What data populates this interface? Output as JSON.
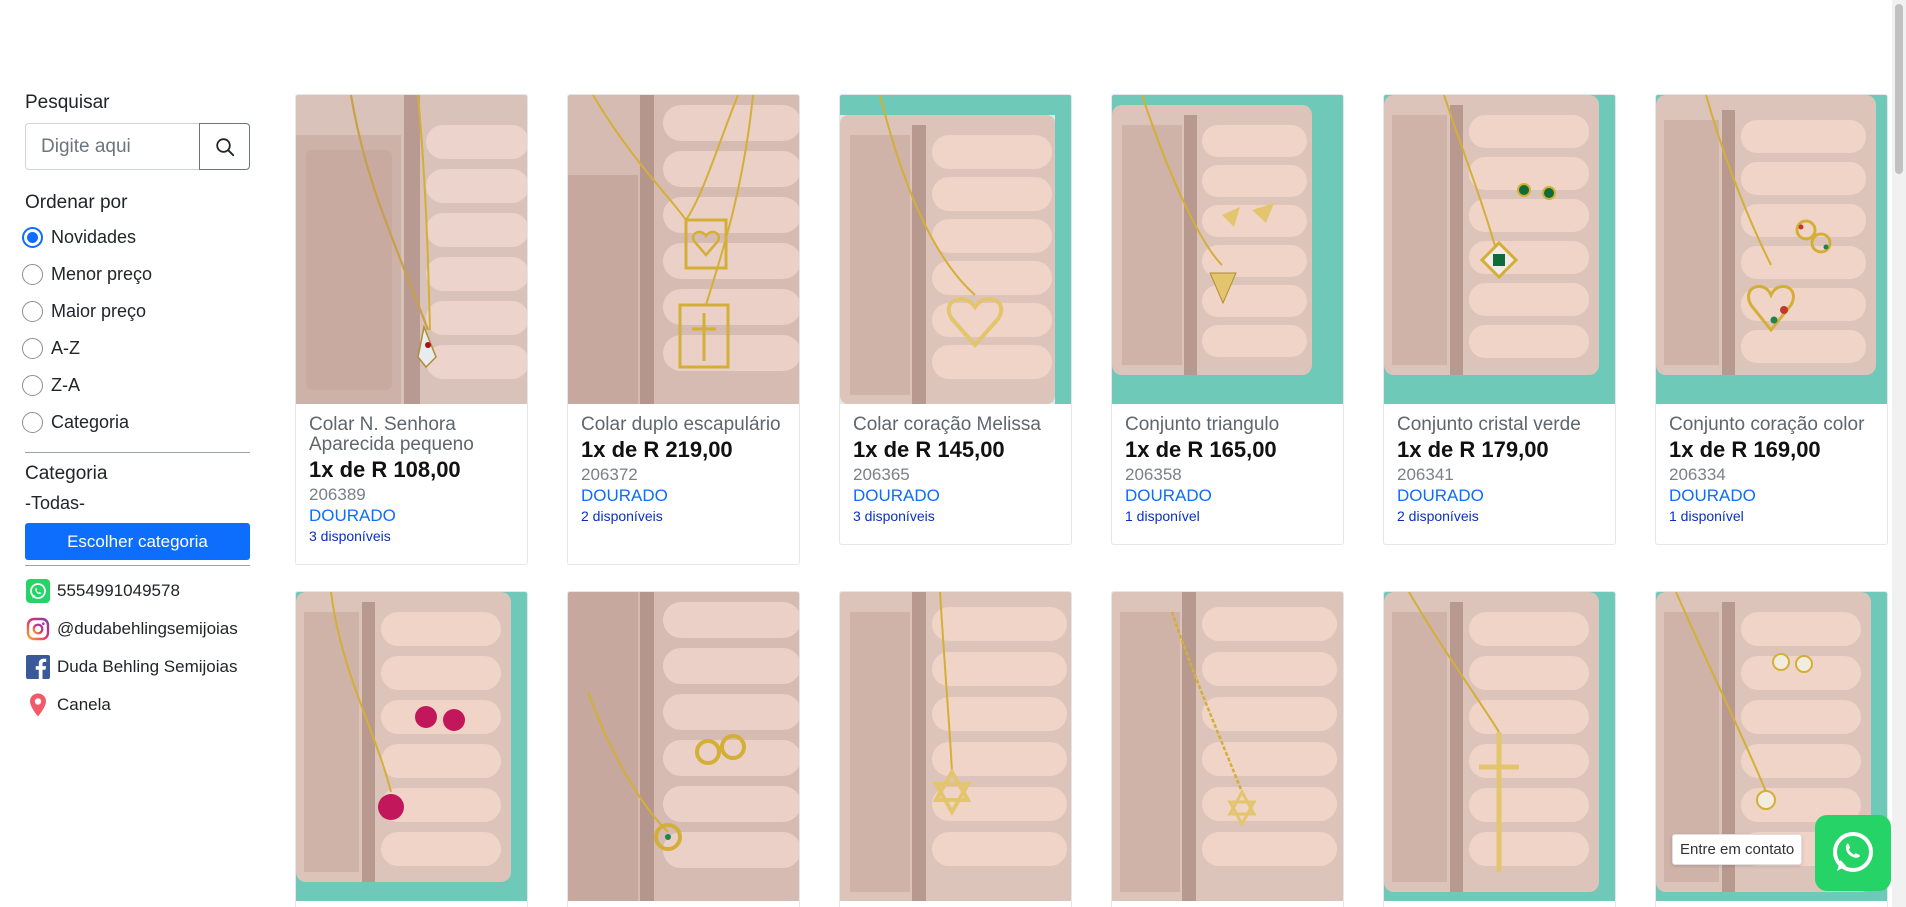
{
  "search": {
    "label": "Pesquisar",
    "placeholder": "Digite aqui"
  },
  "order": {
    "title": "Ordenar por",
    "options": [
      "Novidades",
      "Menor preço",
      "Maior preço",
      "A-Z",
      "Z-A",
      "Categoria"
    ],
    "selected": "Novidades"
  },
  "category": {
    "title": "Categoria",
    "value": "-Todas-",
    "button": "Escolher categoria"
  },
  "contacts": {
    "phone": "5554991049578",
    "instagram": "@dudabehlingsemijoias",
    "facebook": "Duda Behling Semijoias",
    "location": "Canela"
  },
  "products": [
    {
      "name": "Colar N. Senhora Aparecida pequeno",
      "price": "1x de R 108,00",
      "code": "206389",
      "color": "DOURADO",
      "stock": "3 disponíveis"
    },
    {
      "name": "Colar duplo escapulário",
      "price": "1x de R 219,00",
      "code": "206372",
      "color": "DOURADO",
      "stock": "2 disponíveis"
    },
    {
      "name": "Colar coração Melissa",
      "price": "1x de R 145,00",
      "code": "206365",
      "color": "DOURADO",
      "stock": "3 disponíveis"
    },
    {
      "name": "Conjunto triangulo",
      "price": "1x de R 165,00",
      "code": "206358",
      "color": "DOURADO",
      "stock": "1 disponível"
    },
    {
      "name": "Conjunto cristal verde",
      "price": "1x de R 179,00",
      "code": "206341",
      "color": "DOURADO",
      "stock": "2 disponíveis"
    },
    {
      "name": "Conjunto coração color",
      "price": "1x de R 169,00",
      "code": "206334",
      "color": "DOURADO",
      "stock": "1 disponível"
    }
  ],
  "whatsapp": {
    "tooltip": "Entre em contato"
  },
  "colors": {
    "accent": "#0d6efd",
    "whatsapp": "#25d366",
    "box_teal": "#6fc9b9",
    "velvet": "#f0d4c8"
  }
}
